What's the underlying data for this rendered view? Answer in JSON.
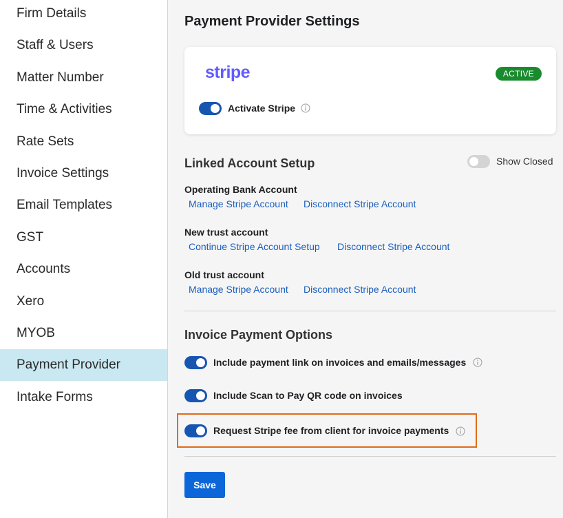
{
  "sidebar": {
    "items": [
      {
        "label": "Firm Details"
      },
      {
        "label": "Staff & Users"
      },
      {
        "label": "Matter Number"
      },
      {
        "label": "Time & Activities"
      },
      {
        "label": "Rate Sets"
      },
      {
        "label": "Invoice Settings"
      },
      {
        "label": "Email Templates"
      },
      {
        "label": "GST"
      },
      {
        "label": "Accounts"
      },
      {
        "label": "Xero"
      },
      {
        "label": "MYOB"
      },
      {
        "label": "Payment Provider",
        "active": true
      },
      {
        "label": "Intake Forms"
      }
    ]
  },
  "page": {
    "title": "Payment Provider Settings"
  },
  "stripe_card": {
    "logo_text": "stripe",
    "status_badge": "ACTIVE",
    "activate_label": "Activate Stripe",
    "activate_on": true
  },
  "linked_accounts": {
    "title": "Linked Account Setup",
    "show_closed_label": "Show Closed",
    "show_closed_on": false,
    "accounts": [
      {
        "name": "Operating Bank Account",
        "primary_link": "Manage Stripe Account",
        "secondary_link": "Disconnect Stripe Account"
      },
      {
        "name": "New trust account",
        "primary_link": "Continue Stripe Account Setup",
        "secondary_link": "Disconnect Stripe Account"
      },
      {
        "name": "Old trust account",
        "primary_link": "Manage Stripe Account",
        "secondary_link": "Disconnect Stripe Account"
      }
    ]
  },
  "invoice_options": {
    "title": "Invoice Payment Options",
    "options": [
      {
        "label": "Include payment link on invoices and emails/messages",
        "on": true,
        "info": true
      },
      {
        "label": "Include Scan to Pay QR code on invoices",
        "on": true,
        "info": false
      },
      {
        "label": "Request Stripe fee from client for invoice payments",
        "on": true,
        "info": true,
        "highlighted": true
      }
    ]
  },
  "actions": {
    "save_label": "Save"
  },
  "colors": {
    "accent": "#0a66d9",
    "toggle_on": "#1656b0",
    "link": "#1a5fbf",
    "active_badge": "#1a8a2e",
    "sidebar_active": "#c9e8f1",
    "stripe_brand": "#635bff",
    "highlight_border": "#e06b17"
  }
}
